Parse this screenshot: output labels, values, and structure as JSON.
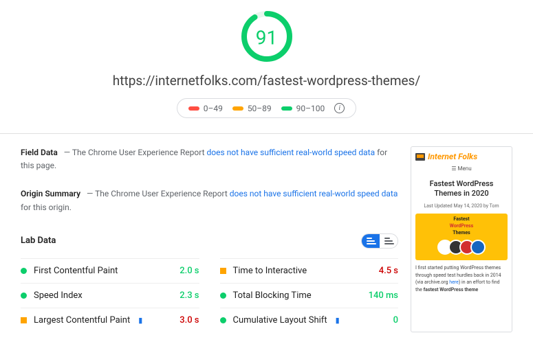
{
  "gauge": {
    "score": "91"
  },
  "url": "https://internetfolks.com/fastest-wordpress-themes/",
  "legend": {
    "bad": "0–49",
    "avg": "50–89",
    "good": "90–100"
  },
  "fieldData": {
    "title": "Field Data",
    "pre": " — The Chrome User Experience Report ",
    "link": "does not have sufficient real-world speed data",
    "post": " for this page."
  },
  "originSummary": {
    "title": "Origin Summary",
    "pre": " — The Chrome User Experience Report ",
    "link": "does not have sufficient real-world speed data",
    "post": " for this origin."
  },
  "labData": {
    "title": "Lab Data"
  },
  "metrics": {
    "fcp": {
      "name": "First Contentful Paint",
      "value": "2.0 s"
    },
    "si": {
      "name": "Speed Index",
      "value": "2.3 s"
    },
    "lcp": {
      "name": "Largest Contentful Paint",
      "value": "3.0 s"
    },
    "tti": {
      "name": "Time to Interactive",
      "value": "4.5 s"
    },
    "tbt": {
      "name": "Total Blocking Time",
      "value": "140 ms"
    },
    "cls": {
      "name": "Cumulative Layout Shift",
      "value": "0"
    }
  },
  "screenshot": {
    "brand": "Internet Folks",
    "menu": "☰ Menu",
    "title": "Fastest WordPress Themes in 2020",
    "date": "Last Updated May 14, 2020 by Tom",
    "banner1": "Fastest",
    "banner2": "WordPress",
    "banner3": "Themes",
    "para_pre": "I first started putting WordPress themes through speed test hurdles back in 2014 (via archive.org ",
    "para_link": "here",
    "para_mid": ") in an effort to find the ",
    "para_bold": "fastest WordPress theme"
  }
}
